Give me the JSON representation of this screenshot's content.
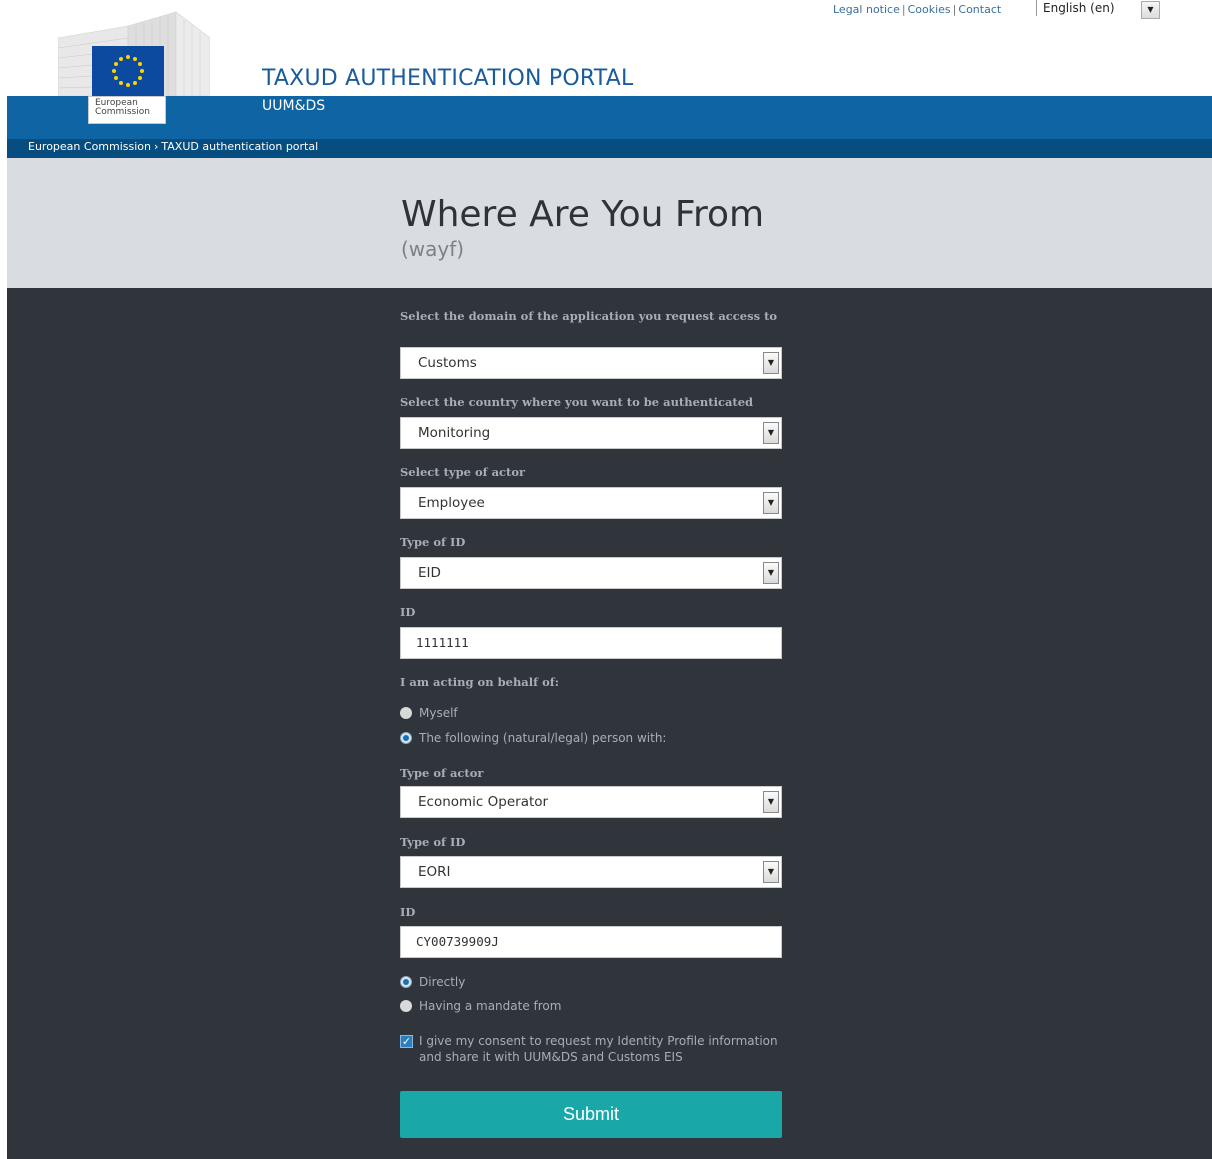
{
  "top_links": {
    "legal_notice": "Legal notice",
    "cookies": "Cookies",
    "contact": "Contact",
    "separator": "|",
    "language": "English (en)",
    "language_arrow": "▼"
  },
  "header": {
    "logo_text": "European\nCommission",
    "title": "TAXUD AUTHENTICATION PORTAL",
    "subtitle": "UUM&DS"
  },
  "breadcrumb": {
    "item1": "European Commission",
    "separator": "›",
    "item2": "TAXUD authentication portal"
  },
  "page": {
    "title": "Where Are You From",
    "subtitle": "(wayf)"
  },
  "form": {
    "domain_label": "Select the domain of the application you request access to",
    "domain_value": "Customs",
    "country_label": "Select the country where you want to be authenticated",
    "country_value": "Monitoring",
    "actor_label": "Select type of actor",
    "actor_value": "Employee",
    "id_type_label": "Type of ID",
    "id_type_value": "EID",
    "id_label": "ID",
    "id_value": "1111111",
    "behalf_label": "I am acting on behalf of:",
    "behalf_options": {
      "myself": "Myself",
      "other": "The following (natural/legal) person with:"
    },
    "behalf_selected": "other",
    "actor2_label": "Type of actor",
    "actor2_value": "Economic Operator",
    "id_type2_label": "Type of ID",
    "id_type2_value": "EORI",
    "id2_label": "ID",
    "id2_value": "CY00739909J",
    "mandate_options": {
      "directly": "Directly",
      "mandate": "Having a mandate from"
    },
    "mandate_selected": "directly",
    "consent_text": "I give my consent to request my Identity Profile information and share it with UUM&DS and Customs EIS",
    "consent_checked": true,
    "submit_label": "Submit",
    "arrow": "▼",
    "check_mark": "✓"
  },
  "colors": {
    "header_blue": "#0f64a3",
    "breadcrumb_blue": "#084d80",
    "form_background": "#2f353b",
    "submit_teal": "#1aa7a8"
  }
}
